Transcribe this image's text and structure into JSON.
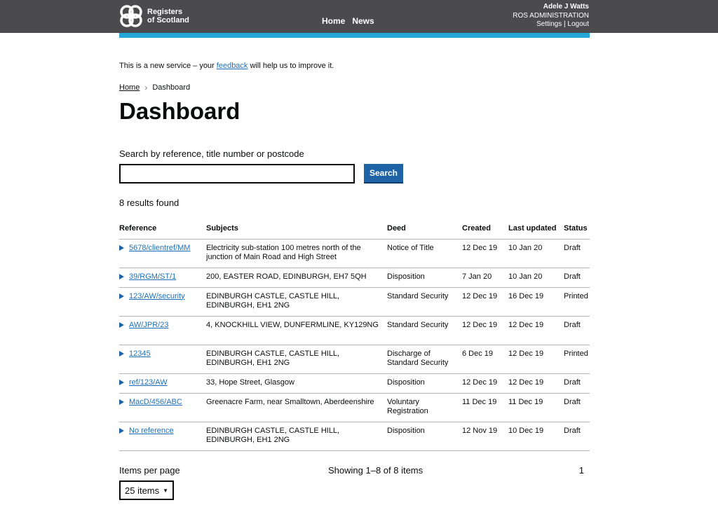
{
  "header": {
    "logo_line1": "Registers",
    "logo_line2": "of Scotland",
    "nav": [
      {
        "label": "Home"
      },
      {
        "label": "News"
      }
    ],
    "user_name": "Adele J Watts",
    "user_org": "ROS ADMINISTRATION",
    "settings_label": "Settings",
    "separator": "|",
    "logout_label": "Logout"
  },
  "beta": {
    "prefix": "This is a new service – your",
    "link": "feedback",
    "suffix": "will help us to improve it."
  },
  "breadcrumb": {
    "home": "Home",
    "current": "Dashboard"
  },
  "page_title": "Dashboard",
  "search": {
    "label": "Search by reference, title number or postcode",
    "value": "",
    "button_label": "Search"
  },
  "results_count": "8 results found",
  "table": {
    "headers": [
      "Reference",
      "Subjects",
      "Deed",
      "Created",
      "Last updated",
      "Status"
    ],
    "rows": [
      {
        "reference": "5678/clientref/MM",
        "subjects": "Electricity sub-station 100 metres north of the junction of Main Road and High Street",
        "deed": "Notice of Title",
        "created": "12 Dec 19",
        "updated": "10 Jan 20",
        "status": "Draft"
      },
      {
        "reference": "39/RGM/ST/1",
        "subjects": "200, EASTER ROAD, EDINBURGH, EH7 5QH",
        "deed": "Disposition",
        "created": "7 Jan 20",
        "updated": "10 Jan 20",
        "status": "Draft"
      },
      {
        "reference": "123/AW/security",
        "subjects": "EDINBURGH CASTLE, CASTLE HILL, EDINBURGH, EH1 2NG",
        "deed": "Standard Security",
        "created": "12 Dec 19",
        "updated": "16 Dec 19",
        "status": "Printed"
      },
      {
        "reference": "AW/JPR/23",
        "subjects": "4, KNOCKHILL VIEW, DUNFERMLINE, KY129NG",
        "deed": "Standard Security",
        "created": "12 Dec 19",
        "updated": "12 Dec 19",
        "status": "Draft"
      },
      {
        "reference": "12345",
        "subjects": "EDINBURGH CASTLE, CASTLE HILL, EDINBURGH, EH1 2NG",
        "deed": "Discharge of Standard Security",
        "created": "6 Dec 19",
        "updated": "12 Dec 19",
        "status": "Printed"
      },
      {
        "reference": "ref/123/AW",
        "subjects": "33, Hope Street, Glasgow",
        "deed": "Disposition",
        "created": "12 Dec 19",
        "updated": "12 Dec 19",
        "status": "Draft"
      },
      {
        "reference": "MacD/456/ABC",
        "subjects": "Greenacre Farm, near Smalltown, Aberdeenshire",
        "deed": "Voluntary Registration",
        "created": "11 Dec 19",
        "updated": "11 Dec 19",
        "status": "Draft"
      },
      {
        "reference": "No reference",
        "subjects": "EDINBURGH CASTLE, CASTLE HILL, EDINBURGH, EH1 2NG",
        "deed": "Disposition",
        "created": "12 Nov 19",
        "updated": "10 Dec 19",
        "status": "Draft"
      }
    ]
  },
  "pagination": {
    "items_per_page_label": "Items per page",
    "items_per_page_value": "25 items",
    "showing": "Showing 1–8 of 8 items",
    "page": "1"
  }
}
